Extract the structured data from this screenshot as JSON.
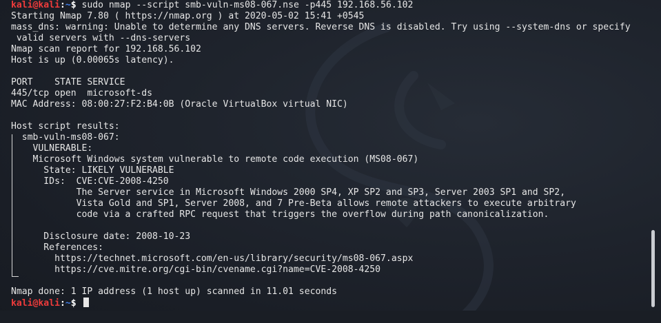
{
  "prompt": {
    "user": "kali@kali",
    "separator": ":",
    "path": "~",
    "symbol": "$"
  },
  "command": " sudo nmap --script smb-vuln-ms08-067.nse -p445 192.168.56.102",
  "output": {
    "starting": "Starting Nmap 7.80 ( https://nmap.org ) at 2020-05-02 15:41 +0545",
    "dns_warning_1": "mass_dns: warning: Unable to determine any DNS servers. Reverse DNS is disabled. Try using --system-dns or specify",
    "dns_warning_2": " valid servers with --dns-servers",
    "scan_report": "Nmap scan report for 192.168.56.102",
    "host_up": "Host is up (0.00065s latency).",
    "blank": "",
    "port_header": "PORT    STATE SERVICE",
    "port_row": "445/tcp open  microsoft-ds",
    "mac": "MAC Address: 08:00:27:F2:B4:0B (Oracle VirtualBox virtual NIC)",
    "host_script": "Host script results:",
    "script_name": "  smb-vuln-ms08-067:",
    "vulnerable": "    VULNERABLE:",
    "vuln_title": "    Microsoft Windows system vulnerable to remote code execution (MS08-067)",
    "state": "      State: LIKELY VULNERABLE",
    "ids": "      IDs:  CVE:CVE-2008-4250",
    "desc_1": "            The Server service in Microsoft Windows 2000 SP4, XP SP2 and SP3, Server 2003 SP1 and SP2,",
    "desc_2": "            Vista Gold and SP1, Server 2008, and 7 Pre-Beta allows remote attackers to execute arbitrary",
    "desc_3": "            code via a crafted RPC request that triggers the overflow during path canonicalization.",
    "disclosure": "      Disclosure date: 2008-10-23",
    "references": "      References:",
    "ref_1": "        https://technet.microsoft.com/en-us/library/security/ms08-067.aspx",
    "ref_2": "        https://cve.mitre.org/cgi-bin/cvename.cgi?name=CVE-2008-4250",
    "done": "Nmap done: 1 IP address (1 host up) scanned in 11.01 seconds"
  },
  "colors": {
    "background": "#1f242d",
    "text": "#e6e6e6",
    "prompt_user": "#ee3b3b",
    "prompt_path": "#3f7de8",
    "scrollbar": "#c9ccd1"
  },
  "icons": {
    "background_watermark": "kali-dragon-icon"
  }
}
